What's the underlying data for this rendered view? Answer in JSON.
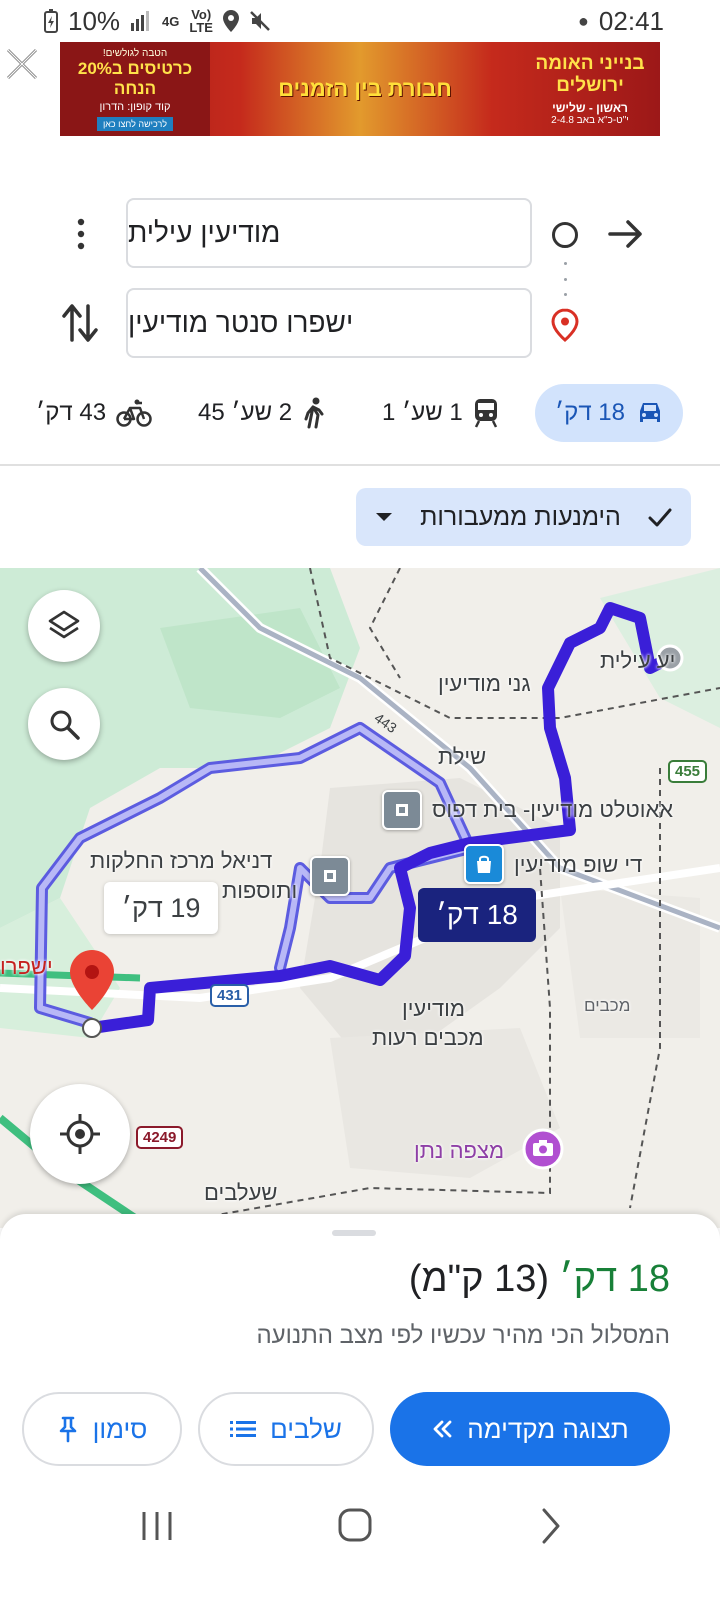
{
  "status_bar": {
    "battery": "10%",
    "network": "4G",
    "volte_top": "Vo)",
    "volte_bottom": "LTE",
    "time": "02:41"
  },
  "ad": {
    "left_small": "הטבה לגולשים!",
    "left_big": "כרטיסים ב20% הנחה",
    "left_code": "קוד קופון: הדרון",
    "left_cta": "לרכישה לחצו כאן",
    "mid_title": "חבורת בין הזמנים",
    "right_title": "בנייני האומה ירושלים",
    "right_days": "ראשון - שלישי",
    "right_dates": "י\"ט-כ\"א באב 2-4.8"
  },
  "directions": {
    "origin": "מודיעין עילית",
    "destination": "ישפרו סנטר מודיעין"
  },
  "modes": {
    "drive": "18 דק׳",
    "transit": "1 שע׳ 1",
    "walk": "2 שע׳ 45",
    "bike": "43 דק׳",
    "selected": "drive"
  },
  "options": {
    "label": "הימנעות ממעבורות"
  },
  "map": {
    "labels": {
      "ganei_modiin": "גני מודיעין",
      "modiin_ilit_partial": "יע עילית",
      "shilat": "שילת",
      "outlet": "אאוטלט מודיעין- בית דפוס",
      "dyo_shop": "די שופ מודיעין",
      "daniel_line1": "דניאל מרכז החלקות",
      "daniel_line2": "ותוספות",
      "modiin_line1": "מודיעין",
      "modiin_line2": "מכבים רעות",
      "maccabim": "מכבים",
      "mitzpe_natan": "מצפה נתן",
      "shaalvim": "שעלבים",
      "yeshpro_partial": "ישפרו"
    },
    "road_shields": [
      "431",
      "4249",
      "455"
    ],
    "road_label_443": "443",
    "route_main_time": "18 דק׳",
    "route_alt_time": "19 דק׳",
    "route_color": "#3a1fd8",
    "alt_route_color": "#8f8ff0"
  },
  "sheet": {
    "time": "18 דק׳",
    "distance": "(13 ק\"מ)",
    "subtitle": "המסלול הכי מהיר עכשיו לפי מצב התנועה",
    "start_label": "תצוגה מקדימה",
    "steps_label": "שלבים",
    "pin_label": "סימון"
  }
}
